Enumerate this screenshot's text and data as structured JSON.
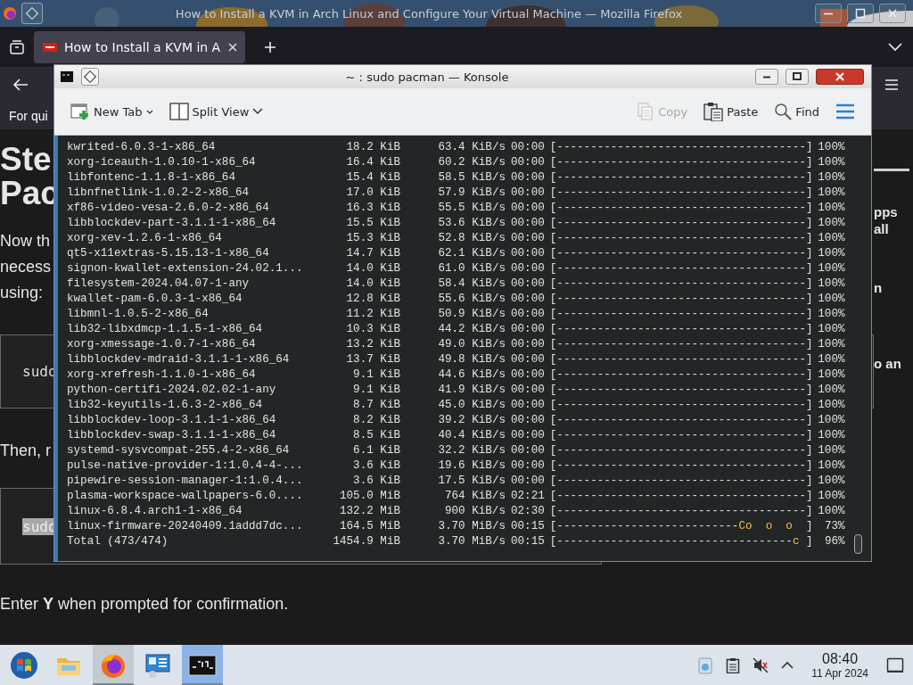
{
  "firefox": {
    "title": "How to Install a KVM in Arch Linux and Configure Your Virtual Machine — Mozilla Firefox",
    "tabs": [
      {
        "title": "How to Install a KVM in A",
        "selected": true
      }
    ],
    "bookmarks_text": "For qui"
  },
  "article": {
    "heading": [
      "Ste",
      "Pac"
    ],
    "paragraph_lines": [
      "Now th",
      "necess",
      "using:"
    ],
    "code_1": {
      "text": "sudo",
      "highlighted": false
    },
    "paragraph_2": "Then, r",
    "code_2": {
      "text": "sudo",
      "highlighted": true
    },
    "confirm": "Enter **Y** when prompted for confirmation."
  },
  "sidebar_snippets": [
    "pps",
    "all",
    "n",
    "o an"
  ],
  "konsole": {
    "title": "~ : sudo pacman — Konsole",
    "toolbar": [
      {
        "kind": "new-tab",
        "label": "New Tab",
        "disabled": false
      },
      {
        "kind": "split-view",
        "label": "Split View",
        "disabled": false
      },
      {
        "kind": "copy",
        "label": "Copy",
        "disabled": true
      },
      {
        "kind": "paste",
        "label": "Paste",
        "disabled": false
      },
      {
        "kind": "find",
        "label": "Find",
        "disabled": false
      },
      {
        "kind": "menu"
      }
    ],
    "rows": [
      {
        "name": "kwrited-6.0.3-1-x86_64",
        "size": "18.2 KiB",
        "rate": "63.4 KiB/s",
        "time": "00:00",
        "bar": "[-------------------------------------]",
        "percent": "100%"
      },
      {
        "name": "xorg-iceauth-1.0.10-1-x86_64",
        "size": "16.4 KiB",
        "rate": "60.2 KiB/s",
        "time": "00:00",
        "bar": "[-------------------------------------]",
        "percent": "100%"
      },
      {
        "name": "libfontenc-1.1.8-1-x86_64",
        "size": "15.4 KiB",
        "rate": "58.5 KiB/s",
        "time": "00:00",
        "bar": "[-------------------------------------]",
        "percent": "100%"
      },
      {
        "name": "libnfnetlink-1.0.2-2-x86_64",
        "size": "17.0 KiB",
        "rate": "57.9 KiB/s",
        "time": "00:00",
        "bar": "[-------------------------------------]",
        "percent": "100%"
      },
      {
        "name": "xf86-video-vesa-2.6.0-2-x86_64",
        "size": "16.3 KiB",
        "rate": "55.5 KiB/s",
        "time": "00:00",
        "bar": "[-------------------------------------]",
        "percent": "100%"
      },
      {
        "name": "libblockdev-part-3.1.1-1-x86_64",
        "size": "15.5 KiB",
        "rate": "53.6 KiB/s",
        "time": "00:00",
        "bar": "[-------------------------------------]",
        "percent": "100%"
      },
      {
        "name": "xorg-xev-1.2.6-1-x86_64",
        "size": "15.3 KiB",
        "rate": "52.8 KiB/s",
        "time": "00:00",
        "bar": "[-------------------------------------]",
        "percent": "100%"
      },
      {
        "name": "qt5-x11extras-5.15.13-1-x86_64",
        "size": "14.7 KiB",
        "rate": "62.1 KiB/s",
        "time": "00:00",
        "bar": "[-------------------------------------]",
        "percent": "100%"
      },
      {
        "name": "signon-kwallet-extension-24.02.1...",
        "size": "14.0 KiB",
        "rate": "61.0 KiB/s",
        "time": "00:00",
        "bar": "[-------------------------------------]",
        "percent": "100%"
      },
      {
        "name": "filesystem-2024.04.07-1-any",
        "size": "14.0 KiB",
        "rate": "58.4 KiB/s",
        "time": "00:00",
        "bar": "[-------------------------------------]",
        "percent": "100%"
      },
      {
        "name": "kwallet-pam-6.0.3-1-x86_64",
        "size": "12.8 KiB",
        "rate": "55.6 KiB/s",
        "time": "00:00",
        "bar": "[-------------------------------------]",
        "percent": "100%"
      },
      {
        "name": "libmnl-1.0.5-2-x86_64",
        "size": "11.2 KiB",
        "rate": "50.9 KiB/s",
        "time": "00:00",
        "bar": "[-------------------------------------]",
        "percent": "100%"
      },
      {
        "name": "lib32-libxdmcp-1.1.5-1-x86_64",
        "size": "10.3 KiB",
        "rate": "44.2 KiB/s",
        "time": "00:00",
        "bar": "[-------------------------------------]",
        "percent": "100%"
      },
      {
        "name": "xorg-xmessage-1.0.7-1-x86_64",
        "size": "13.2 KiB",
        "rate": "49.0 KiB/s",
        "time": "00:00",
        "bar": "[-------------------------------------]",
        "percent": "100%"
      },
      {
        "name": "libblockdev-mdraid-3.1.1-1-x86_64",
        "size": "13.7 KiB",
        "rate": "49.8 KiB/s",
        "time": "00:00",
        "bar": "[-------------------------------------]",
        "percent": "100%"
      },
      {
        "name": "xorg-xrefresh-1.1.0-1-x86_64",
        "size": "9.1 KiB",
        "rate": "44.6 KiB/s",
        "time": "00:00",
        "bar": "[-------------------------------------]",
        "percent": "100%"
      },
      {
        "name": "python-certifi-2024.02.02-1-any",
        "size": "9.1 KiB",
        "rate": "41.9 KiB/s",
        "time": "00:00",
        "bar": "[-------------------------------------]",
        "percent": "100%"
      },
      {
        "name": "lib32-keyutils-1.6.3-2-x86_64",
        "size": "8.7 KiB",
        "rate": "45.0 KiB/s",
        "time": "00:00",
        "bar": "[-------------------------------------]",
        "percent": "100%"
      },
      {
        "name": "libblockdev-loop-3.1.1-1-x86_64",
        "size": "8.2 KiB",
        "rate": "39.2 KiB/s",
        "time": "00:00",
        "bar": "[-------------------------------------]",
        "percent": "100%"
      },
      {
        "name": "libblockdev-swap-3.1.1-1-x86_64",
        "size": "8.5 KiB",
        "rate": "40.4 KiB/s",
        "time": "00:00",
        "bar": "[-------------------------------------]",
        "percent": "100%"
      },
      {
        "name": "systemd-sysvcompat-255.4-2-x86_64",
        "size": "6.1 KiB",
        "rate": "32.2 KiB/s",
        "time": "00:00",
        "bar": "[-------------------------------------]",
        "percent": "100%"
      },
      {
        "name": "pulse-native-provider-1:1.0.4-4-...",
        "size": "3.6 KiB",
        "rate": "19.6 KiB/s",
        "time": "00:00",
        "bar": "[-------------------------------------]",
        "percent": "100%"
      },
      {
        "name": "pipewire-session-manager-1:1.0.4...",
        "size": "3.6 KiB",
        "rate": "17.5 KiB/s",
        "time": "00:00",
        "bar": "[-------------------------------------]",
        "percent": "100%"
      },
      {
        "name": "plasma-workspace-wallpapers-6.0....",
        "size": "105.0 MiB",
        "rate": "764 KiB/s",
        "time": "02:21",
        "bar": "[-------------------------------------]",
        "percent": "100%"
      },
      {
        "name": "linux-6.8.4.arch1-1-x86_64",
        "size": "132.2 MiB",
        "rate": "900 KiB/s",
        "time": "02:30",
        "bar": "[-------------------------------------]",
        "percent": "100%"
      },
      {
        "name": "linux-firmware-20240409.1addd7dc...",
        "size": "164.5 MiB",
        "rate": "3.70 MiB/s",
        "time": "00:15",
        "bar": "[---------------------------",
        "pacman": "Co  o  o ",
        "bar_end": " ]",
        "percent": "73%"
      },
      {
        "name": "Total (473/474)",
        "size": "1454.9 MiB",
        "rate": "3.70 MiB/s",
        "time": "00:15",
        "bar": "[-----------------------------------",
        "pacman": "c",
        "bar_end": " ]",
        "percent": "96%"
      }
    ]
  },
  "taskbar": {
    "apps": [
      {
        "kind": "start",
        "running": false,
        "active": false
      },
      {
        "kind": "files",
        "running": false,
        "active": false
      },
      {
        "kind": "firefox",
        "running": true,
        "active": false
      },
      {
        "kind": "system",
        "running": false,
        "active": false
      },
      {
        "kind": "terminal",
        "running": true,
        "active": true
      }
    ],
    "time": "08:40",
    "date": "11 Apr 2024"
  }
}
